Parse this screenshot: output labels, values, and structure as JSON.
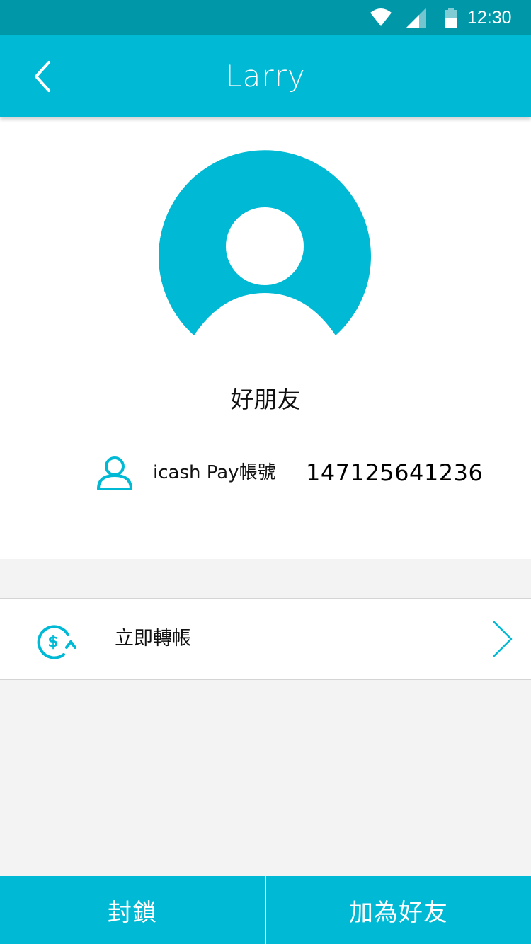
{
  "status_bar": {
    "time": "12:30",
    "icons": [
      "wifi-icon",
      "signal-icon",
      "battery-icon"
    ]
  },
  "app_bar": {
    "title": "Larry",
    "back_icon": "chevron-left-icon"
  },
  "profile": {
    "avatar_icon": "user-avatar-icon",
    "relation": "好朋友",
    "account": {
      "icon": "user-outline-icon",
      "label": "icash Pay帳號",
      "value": "147125641236"
    }
  },
  "transfer": {
    "icon": "dollar-transfer-icon",
    "label": "立即轉帳",
    "chevron_icon": "chevron-right-icon"
  },
  "actions": {
    "block_label": "封鎖",
    "add_friend_label": "加為好友"
  },
  "colors": {
    "status_bar": "#0098a9",
    "primary": "#00bad5",
    "background": "#f3f3f3",
    "surface": "#ffffff"
  }
}
